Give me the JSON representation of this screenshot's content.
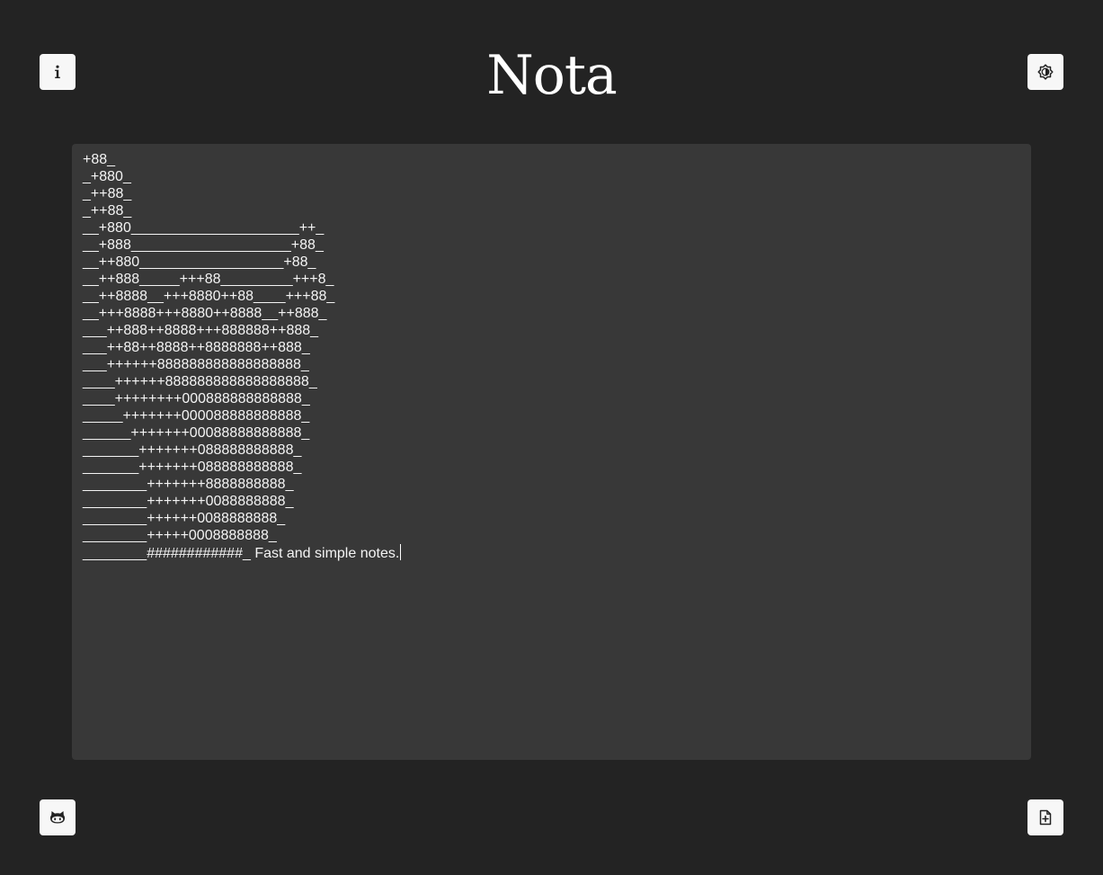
{
  "app": {
    "title": "Nota"
  },
  "toolbar": {
    "info_icon": "info-icon",
    "theme_icon": "brightness-icon",
    "github_icon": "github-icon",
    "new_note_icon": "file-plus-icon"
  },
  "editor": {
    "content": "+88_\n_+880_\n_++88_\n_++88_\n__+880_____________________++_\n__+888____________________+88_\n__++880__________________+88_\n__++888_____+++88_________+++8_\n__++8888__+++8880++88____+++88_\n__+++8888+++8880++8888__++888_\n___++888++8888+++888888++888_\n___++88++8888++8888888++888_\n___++++++888888888888888888_\n____++++++888888888888888888_\n____++++++++000888888888888_\n_____+++++++000088888888888_\n______+++++++00088888888888_\n_______+++++++088888888888_\n_______+++++++088888888888_\n________+++++++8888888888_\n________+++++++0088888888_\n________++++++0088888888_\n________+++++0008888888_\n________############_ Fast and simple notes."
  },
  "colors": {
    "background": "#232323",
    "editor_background": "#383838",
    "button_background": "#f7f7f7",
    "text": "#f4f4f4"
  }
}
